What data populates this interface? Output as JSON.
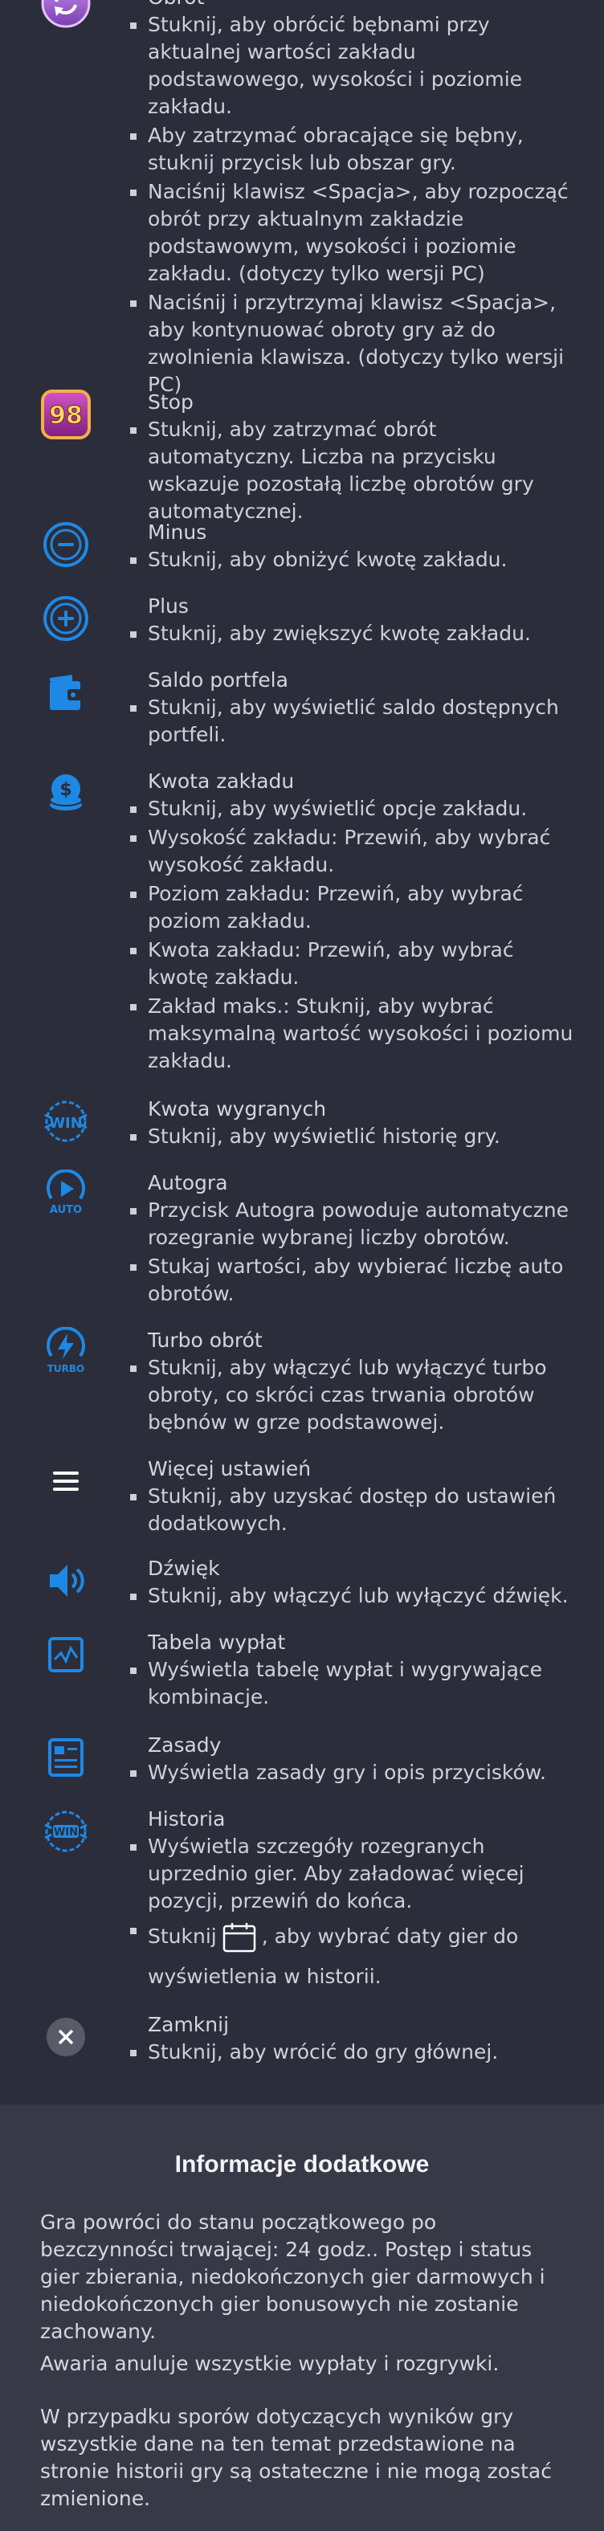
{
  "colors": {
    "accent": "#1e88e5",
    "background": "#2c2d3a",
    "info_background": "#383947"
  },
  "rules": [
    {
      "icon": "spin-icon",
      "title": "Obrót",
      "bullets": [
        "Stuknij, aby obrócić bębnami przy aktualnej wartości zakładu podstawowego, wysokości i poziomie zakładu.",
        "Aby zatrzymać obracające się bębny, stuknij przycisk lub obszar gry.",
        "Naciśnij klawisz <Spacja>, aby rozpocząć obrót przy aktualnym zakładzie podstawowym, wysokości i poziomie zakładu. (dotyczy tylko wersji PC)",
        "Naciśnij i przytrzymaj klawisz <Spacja>, aby kontynuować obroty gry aż do zwolnienia klawisza. (dotyczy tylko wersji PC)"
      ]
    },
    {
      "icon": "stop-counter-icon",
      "icon_text": "98",
      "title": "Stop",
      "bullets": [
        "Stuknij, aby zatrzymać obrót automatyczny. Liczba na przycisku wskazuje pozostałą liczbę obrotów gry automatycznej."
      ]
    },
    {
      "icon": "minus-icon",
      "title": "Minus",
      "bullets": [
        "Stuknij, aby obniżyć kwotę zakładu."
      ]
    },
    {
      "icon": "plus-icon",
      "title": "Plus",
      "bullets": [
        "Stuknij, aby zwiększyć kwotę zakładu."
      ]
    },
    {
      "icon": "wallet-icon",
      "title": "Saldo portfela",
      "bullets": [
        "Stuknij, aby wyświetlić saldo dostępnych portfeli."
      ]
    },
    {
      "icon": "coins-icon",
      "title": "Kwota zakładu",
      "bullets": [
        "Stuknij, aby wyświetlić opcje zakładu.",
        "Wysokość zakładu: Przewiń, aby wybrać wysokość zakładu.",
        "Poziom zakładu: Przewiń, aby wybrać poziom zakładu.",
        "Kwota zakładu: Przewiń, aby wybrać kwotę zakładu.",
        "Zakład maks.: Stuknij, aby wybrać maksymalną wartość wysokości i poziomu zakładu."
      ]
    },
    {
      "icon": "win-icon",
      "icon_text": "WIN",
      "title": "Kwota wygranych",
      "bullets": [
        "Stuknij, aby wyświetlić historię gry."
      ]
    },
    {
      "icon": "auto-play-icon",
      "icon_text": "AUTO",
      "title": "Autogra",
      "bullets": [
        "Przycisk Autogra powoduje automatyczne rozegranie wybranej liczby obrotów.",
        "Stukaj wartości, aby wybierać liczbę auto obrotów."
      ]
    },
    {
      "icon": "turbo-icon",
      "icon_text": "TURBO",
      "title": "Turbo obrót",
      "bullets": [
        "Stuknij, aby włączyć lub wyłączyć turbo obroty, co skróci czas trwania obrotów bębnów w grze podstawowej."
      ]
    },
    {
      "icon": "menu-icon",
      "title": "Więcej ustawień",
      "bullets": [
        "Stuknij, aby uzyskać dostęp do ustawień dodatkowych."
      ]
    },
    {
      "icon": "sound-icon",
      "title": "Dźwięk",
      "bullets": [
        "Stuknij, aby włączyć lub wyłączyć dźwięk."
      ]
    },
    {
      "icon": "paytable-icon",
      "title": "Tabela wypłat",
      "bullets": [
        "Wyświetla tabelę wypłat i wygrywające kombinacje."
      ]
    },
    {
      "icon": "rules-icon",
      "title": "Zasady",
      "bullets": [
        "Wyświetla zasady gry i opis przycisków."
      ]
    },
    {
      "icon": "history-icon",
      "icon_text": "WIN",
      "title": "Historia",
      "bullets": [
        "Wyświetla szczegóły rozegranych uprzednio gier. Aby załadować więcej pozycji, przewiń do końca."
      ],
      "calendar_bullet": {
        "before": "Stuknij",
        "after_line1": ", aby wybrać daty gier do",
        "line2": "wyświetlenia w historii."
      }
    },
    {
      "icon": "close-icon",
      "title": "Zamknij",
      "bullets": [
        "Stuknij, aby wrócić do gry głównej."
      ]
    }
  ],
  "info": {
    "title": "Informacje dodatkowe",
    "paragraphs": [
      "Gra powróci do stanu początkowego po bezczynności trwającej: 24 godz.. Postęp i status gier zbierania, niedokończonych gier darmowych i niedokończonych gier bonusowych nie zostanie zachowany.",
      "Awaria anuluje wszystkie wypłaty i rozgrywki.",
      "W przypadku sporów dotyczących wyników gry wszystkie dane na ten temat przedstawione na stronie historii gry są ostateczne i nie mogą zostać zmienione."
    ]
  }
}
